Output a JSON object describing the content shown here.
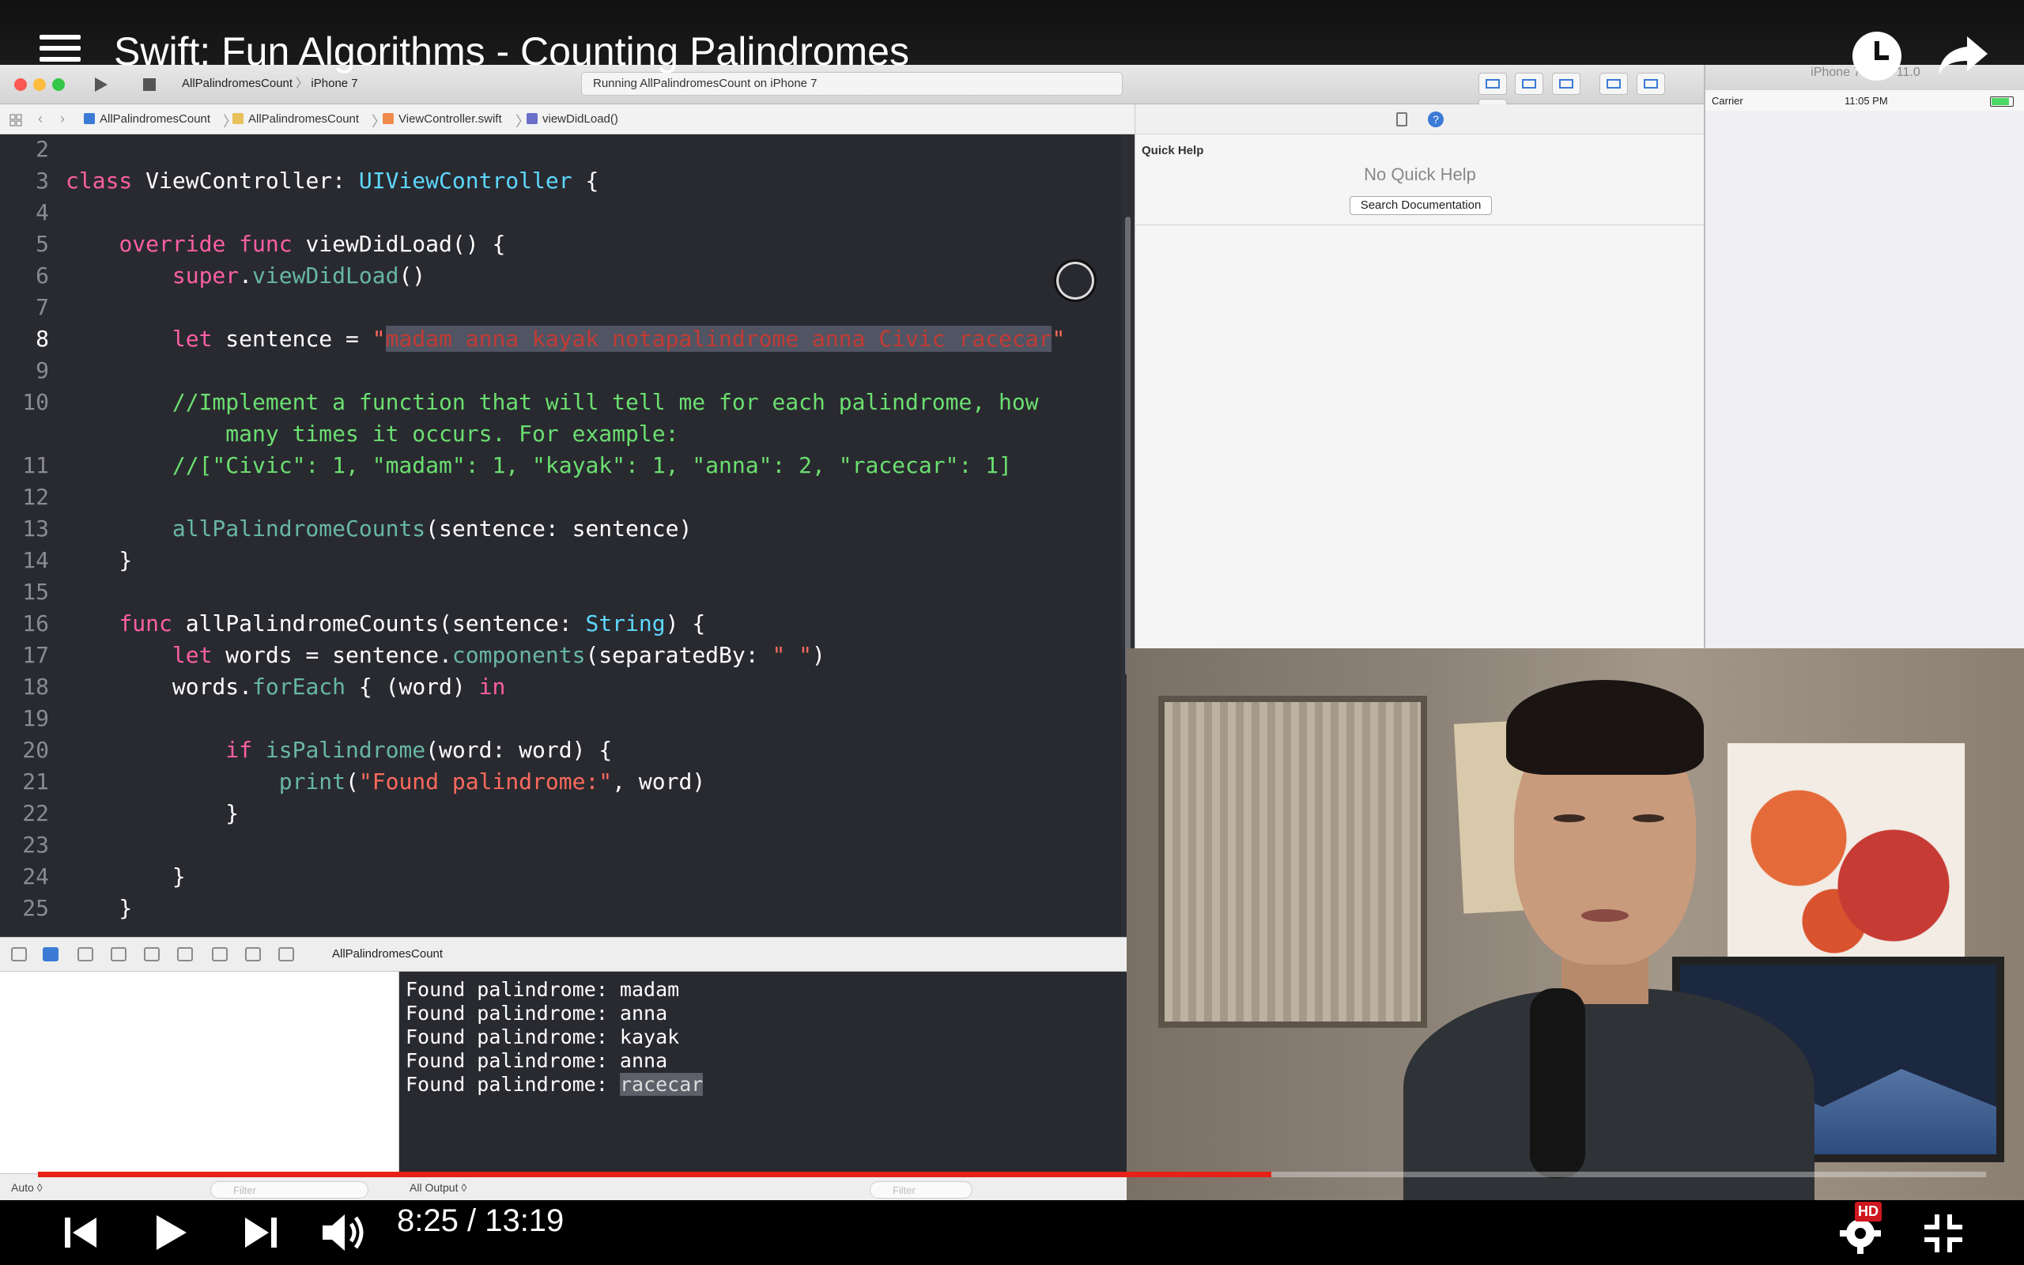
{
  "video": {
    "title": "Swift: Fun Algorithms - Counting Palindromes",
    "time_current": "8:25",
    "time_separator": " / ",
    "time_total": "13:19",
    "progress_fraction": 0.633,
    "quality_badge": "HD"
  },
  "xcode": {
    "scheme": "AllPalindromesCount",
    "device": "iPhone 7",
    "status": "Running AllPalindromesCount on iPhone 7",
    "breadcrumb": [
      "AllPalindromesCount",
      "AllPalindromesCount",
      "ViewController.swift",
      "viewDidLoad()"
    ],
    "quick_help": {
      "title": "Quick Help",
      "empty": "No Quick Help",
      "button": "Search Documentation"
    },
    "debug": {
      "target": "AllPalindromesCount",
      "auto_label": "Auto ◊",
      "output_label": "All Output ◊",
      "filter_placeholder": "Filter",
      "console_lines": [
        "Found palindrome: madam",
        "Found palindrome: anna",
        "Found palindrome: kayak",
        "Found palindrome: anna",
        "Found palindrome: racecar"
      ]
    },
    "line_numbers": [
      "2",
      "3",
      "4",
      "5",
      "6",
      "7",
      "8",
      "9",
      "10",
      "",
      "11",
      "12",
      "13",
      "14",
      "15",
      "16",
      "17",
      "18",
      "19",
      "20",
      "21",
      "22",
      "23",
      "24",
      "25"
    ]
  },
  "simulator": {
    "title": "iPhone 7 - iOS 11.0",
    "carrier": "Carrier",
    "clock": "11:05 PM"
  },
  "colors": {
    "accent_red": "#e62117",
    "editor_bg": "#292a30",
    "keyword": "#fc5fa3",
    "type": "#5dd8ff",
    "string": "#fc6a5d",
    "comment": "#6bdf70"
  }
}
